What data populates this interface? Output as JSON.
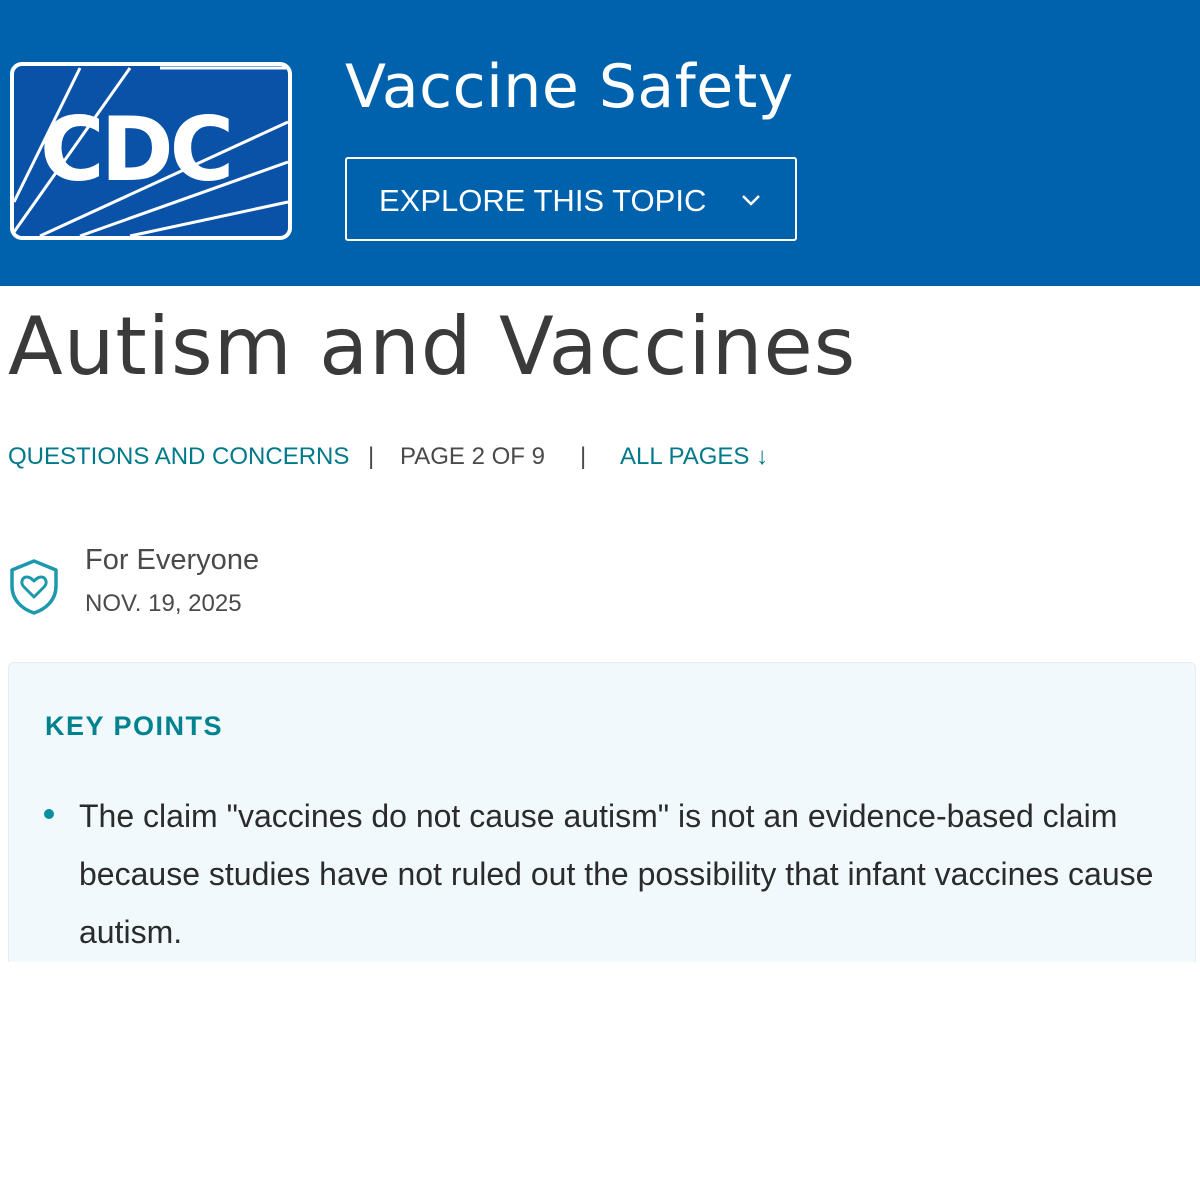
{
  "header": {
    "logo_text": "CDC",
    "site_title": "Vaccine Safety",
    "explore_button_label": "EXPLORE THIS TOPIC",
    "explore_icon": "chevron-down-icon",
    "background_color": "#0062ad"
  },
  "page": {
    "title": "Autism and Vaccines"
  },
  "breadcrumb": {
    "section_link": "QUESTIONS AND CONCERNS",
    "separator": "|",
    "page_indicator": "PAGE 2 OF 9",
    "all_pages_link": "ALL PAGES ↓"
  },
  "meta": {
    "audience_icon": "shield-heart-icon",
    "audience": "For Everyone",
    "date": "NOV. 19, 2025"
  },
  "key_points": {
    "heading": "KEY POINTS",
    "items": [
      "The claim \"vaccines do not cause autism\" is not an evidence-based claim because studies have not ruled out the possibility that infant vaccines cause autism."
    ],
    "accent_color": "#00838f",
    "background_color": "#f1f9fc"
  }
}
